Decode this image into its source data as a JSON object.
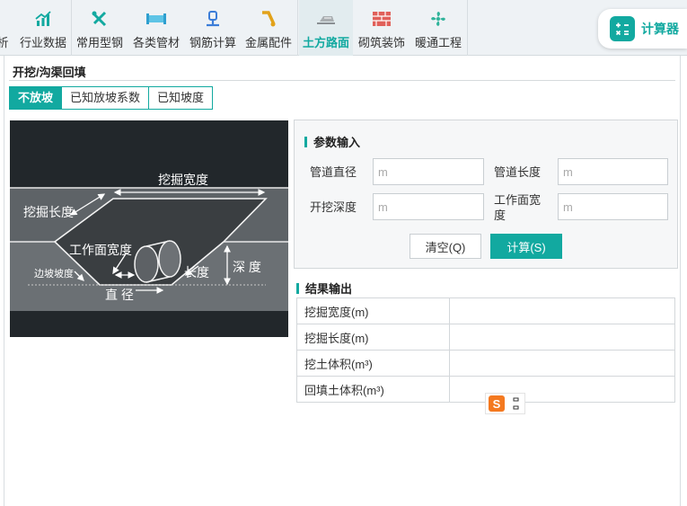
{
  "toolbar": {
    "items": [
      {
        "label": "析",
        "icon": "analysis-icon"
      },
      {
        "label": "行业数据",
        "icon": "bar-chart-icon"
      },
      {
        "label": "常用型钢",
        "icon": "tools-icon"
      },
      {
        "label": "各类管材",
        "icon": "pipe-icon"
      },
      {
        "label": "钢筋计算",
        "icon": "rebar-icon"
      },
      {
        "label": "金属配件",
        "icon": "metal-fitting-icon"
      },
      {
        "label": "土方路面",
        "icon": "earthwork-icon",
        "active": true
      },
      {
        "label": "砌筑装饰",
        "icon": "brick-icon"
      },
      {
        "label": "暖通工程",
        "icon": "fan-icon"
      }
    ],
    "calculator_label": "计算器"
  },
  "page": {
    "title": "开挖/沟渠回填",
    "tabs": [
      {
        "label": "不放坡",
        "active": true
      },
      {
        "label": "已知放坡系数",
        "active": false
      },
      {
        "label": "已知坡度",
        "active": false
      }
    ]
  },
  "figure": {
    "labels": {
      "excavation_width": "挖掘宽度",
      "excavation_length": "挖掘长度",
      "working_width": "工作面宽度",
      "side_slope": "边坡坡度",
      "length": "长度",
      "depth": "深 度",
      "diameter": "直 径"
    }
  },
  "params": {
    "section_title": "参数输入",
    "fields": [
      {
        "label": "管道直径",
        "placeholder": "m",
        "value": ""
      },
      {
        "label": "管道长度",
        "placeholder": "m",
        "value": ""
      },
      {
        "label": "开挖深度",
        "placeholder": "m",
        "value": ""
      },
      {
        "label": "工作面宽度",
        "placeholder": "m",
        "value": ""
      }
    ],
    "clear_label": "清空(Q)",
    "calc_label": "计算(S)"
  },
  "results": {
    "section_title": "结果输出",
    "rows": [
      {
        "name": "挖掘宽度(m)",
        "value": ""
      },
      {
        "name": "挖掘长度(m)",
        "value": ""
      },
      {
        "name": "挖土体积(m³)",
        "value": ""
      },
      {
        "name": "回填土体积(m³)",
        "value": ""
      }
    ]
  },
  "ime": {
    "logo": "S"
  },
  "colors": {
    "accent": "#12a9a0",
    "figure_bg": "#22272b"
  }
}
